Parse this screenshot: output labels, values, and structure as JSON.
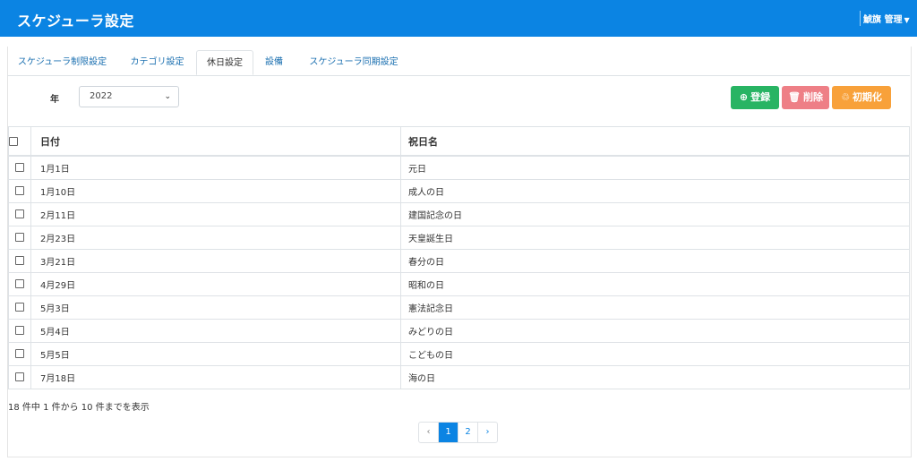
{
  "header": {
    "title": "スケジューラ設定",
    "user": "鯱旗 管理"
  },
  "tabs": [
    {
      "label": "スケジューラ制限設定",
      "active": false
    },
    {
      "label": "カテゴリ設定",
      "active": false
    },
    {
      "label": "休日設定",
      "active": true
    },
    {
      "label": "設備",
      "active": false
    },
    {
      "label": "スケジューラ同期設定",
      "active": false
    }
  ],
  "filter": {
    "year_label": "年",
    "year_value": "2022"
  },
  "actions": {
    "register": "登録",
    "delete": "削除",
    "reset": "初期化"
  },
  "table": {
    "headers": {
      "date": "日付",
      "name": "祝日名"
    },
    "rows": [
      {
        "date": "1月1日",
        "name": "元日"
      },
      {
        "date": "1月10日",
        "name": "成人の日"
      },
      {
        "date": "2月11日",
        "name": "建国記念の日"
      },
      {
        "date": "2月23日",
        "name": "天皇誕生日"
      },
      {
        "date": "3月21日",
        "name": "春分の日"
      },
      {
        "date": "4月29日",
        "name": "昭和の日"
      },
      {
        "date": "5月3日",
        "name": "憲法記念日"
      },
      {
        "date": "5月4日",
        "name": "みどりの日"
      },
      {
        "date": "5月5日",
        "name": "こどもの日"
      },
      {
        "date": "7月18日",
        "name": "海の日"
      }
    ]
  },
  "summary": "18 件中 1 件から 10 件までを表示",
  "pagination": {
    "prev": "‹",
    "pages": [
      "1",
      "2"
    ],
    "current": "1",
    "next": "›"
  },
  "colors": {
    "header_bg": "#0b84e3",
    "register": "#28b463",
    "delete": "#ee7f86",
    "reset": "#f8a13a"
  }
}
